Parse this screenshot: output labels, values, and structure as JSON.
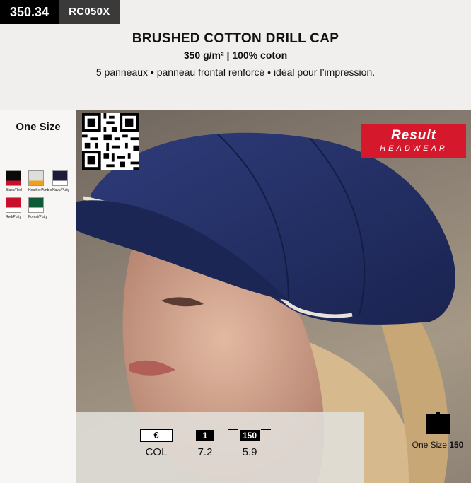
{
  "header": {
    "price": "350.34",
    "code": "RC050X"
  },
  "product": {
    "title": "BRUSHED COTTON DRILL CAP",
    "spec": "350 g/m² | 100% coton",
    "description": "5 panneaux • panneau frontal renforcé • idéal pour l’impression."
  },
  "sizes": {
    "label": "One Size"
  },
  "colors": [
    {
      "name": "Black/Red",
      "main": "#0a0a0a",
      "accent": "#c8102e"
    },
    {
      "name": "Heather/Amber",
      "main": "#dde0d8",
      "accent": "#f0a020"
    },
    {
      "name": "Navy/Putty",
      "main": "#1c1c3a",
      "accent": "#ffffff"
    },
    {
      "name": "Red/Putty",
      "main": "#c8102e",
      "accent": "#ffffff"
    },
    {
      "name": "Forest/Putty",
      "main": "#0d5a36",
      "accent": "#ffffff"
    }
  ],
  "brand": {
    "name": "Result",
    "sub": "HEADWEAR",
    "color": "#d5182b"
  },
  "pricing": {
    "col1": {
      "header": "€",
      "value": "COL"
    },
    "col2": {
      "header": "1",
      "value": "7.2"
    },
    "col3": {
      "header": "150",
      "value": "5.9"
    }
  },
  "packaging": {
    "label": "One Size",
    "qty": "150"
  }
}
